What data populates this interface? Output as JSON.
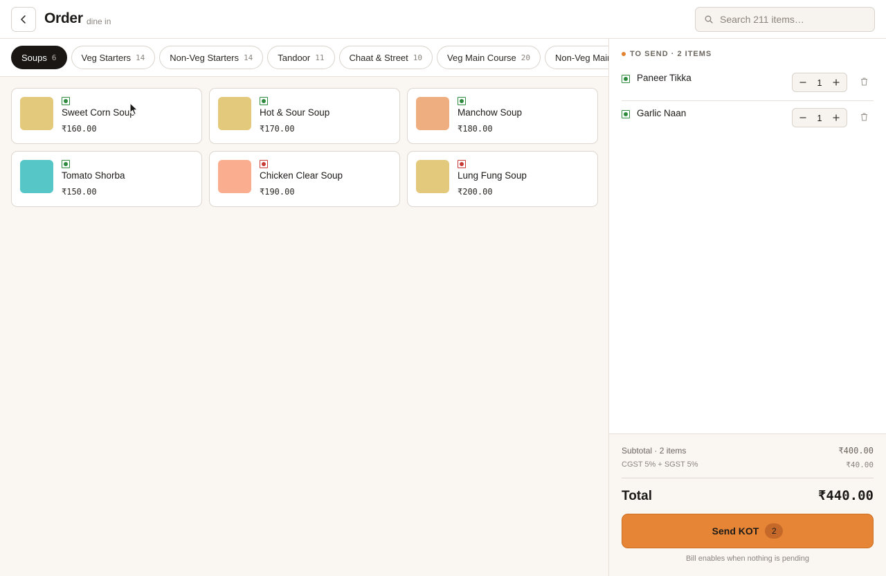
{
  "header": {
    "title": "Order",
    "subtitle": "dine in",
    "search_placeholder": "Search 211 items…"
  },
  "categories": [
    {
      "label": "Soups",
      "count": "6",
      "active": true
    },
    {
      "label": "Veg Starters",
      "count": "14"
    },
    {
      "label": "Non-Veg Starters",
      "count": "14"
    },
    {
      "label": "Tandoor",
      "count": "11"
    },
    {
      "label": "Chaat & Street",
      "count": "10"
    },
    {
      "label": "Veg Main Course",
      "count": "20"
    },
    {
      "label": "Non-Veg Main Course",
      "count": ""
    }
  ],
  "menu": [
    {
      "name": "Sweet Corn Soup",
      "price": "₹160.00",
      "veg": true,
      "color": "#e3c97c"
    },
    {
      "name": "Hot & Sour Soup",
      "price": "₹170.00",
      "veg": true,
      "color": "#e3c97c"
    },
    {
      "name": "Manchow Soup",
      "price": "₹180.00",
      "veg": true,
      "color": "#efae80"
    },
    {
      "name": "Tomato Shorba",
      "price": "₹150.00",
      "veg": true,
      "color": "#56c6c6"
    },
    {
      "name": "Chicken Clear Soup",
      "price": "₹190.00",
      "veg": false,
      "color": "#fbad90"
    },
    {
      "name": "Lung Fung Soup",
      "price": "₹200.00",
      "veg": false,
      "color": "#e3c97c"
    }
  ],
  "order": {
    "section_label": "TO SEND · 2 ITEMS",
    "items": [
      {
        "name": "Paneer Tikka",
        "qty": "1",
        "veg": true
      },
      {
        "name": "Garlic Naan",
        "qty": "1",
        "veg": true
      }
    ],
    "subtotal_label": "Subtotal · 2 items",
    "subtotal_value": "₹400.00",
    "tax_label": "CGST 5% + SGST 5%",
    "tax_value": "₹40.00",
    "total_label": "Total",
    "total_value": "₹440.00",
    "send_label": "Send KOT",
    "send_count": "2",
    "hint": "Bill enables when nothing is pending"
  },
  "colors": {
    "accent": "#e58535",
    "veg": "#2e8b3e",
    "nonveg": "#c83a36",
    "active_chip": "#1a1614"
  }
}
